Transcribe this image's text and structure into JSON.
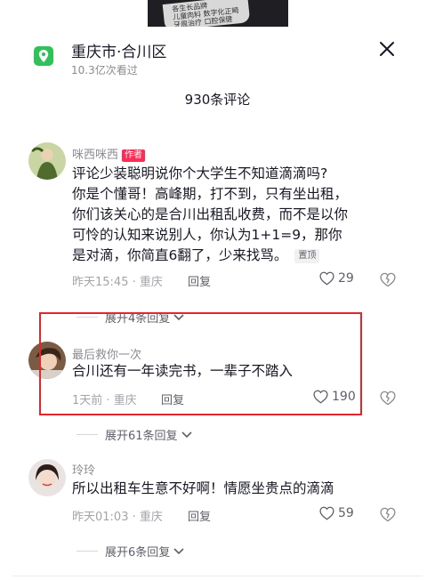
{
  "video_sign_lines": [
    "各生长品牌",
    "儿童肉料 数字化正畸",
    "牙周治疗 口腔保健"
  ],
  "location": {
    "name": "重庆市·合川区",
    "views": "10.3亿次看过",
    "icon": "location-pin-icon",
    "icon_color": "#2fc15a"
  },
  "close_icon": "close-icon",
  "comment_count": "930条评论",
  "accent_color": "#fe2c55",
  "highlight_color": "#e3262b",
  "comments": [
    {
      "username": "咪西咪西",
      "badge": "作者",
      "lines": [
        "评论少装聪明说你个大学生不知道滴滴吗?",
        "你是个懂哥！高峰期，打不到，只有坐出租，",
        "你们该关心的是合川出租乱收费，而不是以你",
        "可怜的认知来说别人，你认为1+1=9，那你",
        "是对滴，你简直6翻了，少来找骂。"
      ],
      "pin_tag": "置顶",
      "meta": "昨天15:45 · 重庆",
      "reply": "回复",
      "likes": "29",
      "expand": "展开4条回复"
    },
    {
      "username": "最后救你一次",
      "lines": [
        "合川还有一年读完书，一辈子不踏入"
      ],
      "meta": "1天前 · 重庆",
      "reply": "回复",
      "likes": "190",
      "expand": "展开61条回复"
    },
    {
      "username": "玲玲",
      "lines": [
        "所以出租车生意不好啊！情愿坐贵点的滴滴"
      ],
      "meta": "昨天01:03 · 重庆",
      "reply": "回复",
      "likes": "59",
      "expand": "展开6条回复"
    }
  ]
}
